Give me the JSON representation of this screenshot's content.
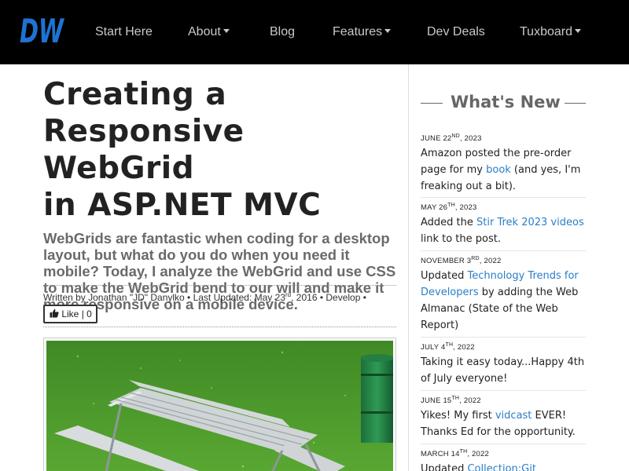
{
  "nav": {
    "logo_text": "DW",
    "items": [
      {
        "label": "Start Here",
        "dropdown": false
      },
      {
        "label": "About",
        "dropdown": true
      },
      {
        "label": "Blog",
        "dropdown": false
      },
      {
        "label": "Features",
        "dropdown": true
      },
      {
        "label": "Dev Deals",
        "dropdown": false
      },
      {
        "label": "Tuxboard",
        "dropdown": true
      }
    ]
  },
  "article": {
    "title_lines": [
      "Creating a",
      "Responsive WebGrid",
      "in ASP.NET MVC"
    ],
    "subtitle": "WebGrids are fantastic when coding for a desktop layout, but what do you do when you need it mobile? Today, I analyze the WebGrid and use CSS to make the WebGrid bend to our will and make it more responsive on a mobile device.",
    "byline": {
      "prefix": "Written by Jonathan \"JD\" Danylko • Last Updated: May 23",
      "ordinal": "rd",
      "suffix": ", 2016 • Develop •"
    },
    "like": {
      "label": "Like | 0"
    }
  },
  "sidebar": {
    "heading": "What's New",
    "items": [
      {
        "date_main": "June 22",
        "date_sup": "nd",
        "date_year": ", 2023",
        "text_before": "Amazon posted the pre-order page for my ",
        "link": "book",
        "text_after": " (and yes, I'm freaking out a bit)."
      },
      {
        "date_main": "May 26",
        "date_sup": "th",
        "date_year": ", 2023",
        "text_before": "Added the ",
        "link": "Stir Trek 2023 videos",
        "text_after": " link to the post."
      },
      {
        "date_main": "November 3",
        "date_sup": "rd",
        "date_year": ", 2022",
        "text_before": "Updated ",
        "link": "Technology Trends for Developers",
        "text_after": " by adding the Web Almanac (State of the Web Report)"
      },
      {
        "date_main": "July 4",
        "date_sup": "th",
        "date_year": ", 2022",
        "text_before": "Taking it easy today...Happy 4th of July everyone!",
        "link": "",
        "text_after": ""
      },
      {
        "date_main": "June 15",
        "date_sup": "th",
        "date_year": ", 2022",
        "text_before": "Yikes! My first ",
        "link": "vidcast",
        "text_after": " EVER! Thanks Ed for the opportunity."
      },
      {
        "date_main": "March 14",
        "date_sup": "th",
        "date_year": ", 2022",
        "text_before": "Updated ",
        "link": "Collection:Git Resources",
        "text_after": ""
      }
    ]
  },
  "colors": {
    "nav_bg": "#000000",
    "nav_text": "#c9c9c9",
    "logo_blue": "#1e73d2",
    "link": "#2a7ec7",
    "subtitle": "#6a6a6a"
  }
}
